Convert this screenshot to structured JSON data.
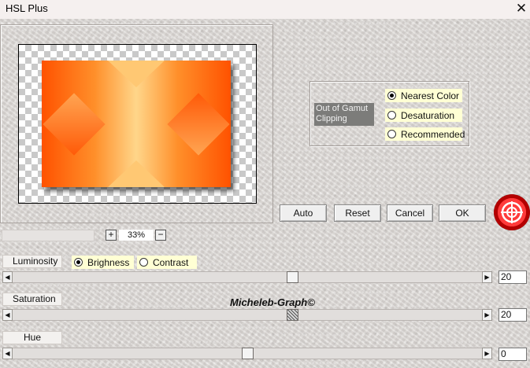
{
  "window": {
    "title": "HSL Plus",
    "close_glyph": "✕"
  },
  "gamut": {
    "label": "Out of Gamut Clipping",
    "options": [
      {
        "label": "Nearest Color",
        "selected": true
      },
      {
        "label": "Desaturation",
        "selected": false
      },
      {
        "label": "Recommended",
        "selected": false
      }
    ]
  },
  "buttons": {
    "auto": "Auto",
    "reset": "Reset",
    "cancel": "Cancel",
    "ok": "OK"
  },
  "zoom": {
    "plus": "+",
    "minus": "−",
    "value": "33%"
  },
  "luminosity": {
    "label": "Luminosity",
    "mode_options": [
      {
        "label": "Brighness",
        "selected": true
      },
      {
        "label": "Contrast",
        "selected": false
      }
    ],
    "value": "20",
    "level": 0.61
  },
  "saturation": {
    "label": "Saturation",
    "value": "20",
    "level": 0.61
  },
  "hue": {
    "label": "Hue",
    "value": "0",
    "level": 0.5
  },
  "scroll_arrows": {
    "left": "◀",
    "right": "▶"
  },
  "watermark": "Micheleb-Graph©",
  "colors": {
    "art_orange": "#ff5200",
    "art_light": "#ffd68a",
    "badge_red": "#e00000",
    "option_bg": "#ffffd4"
  }
}
